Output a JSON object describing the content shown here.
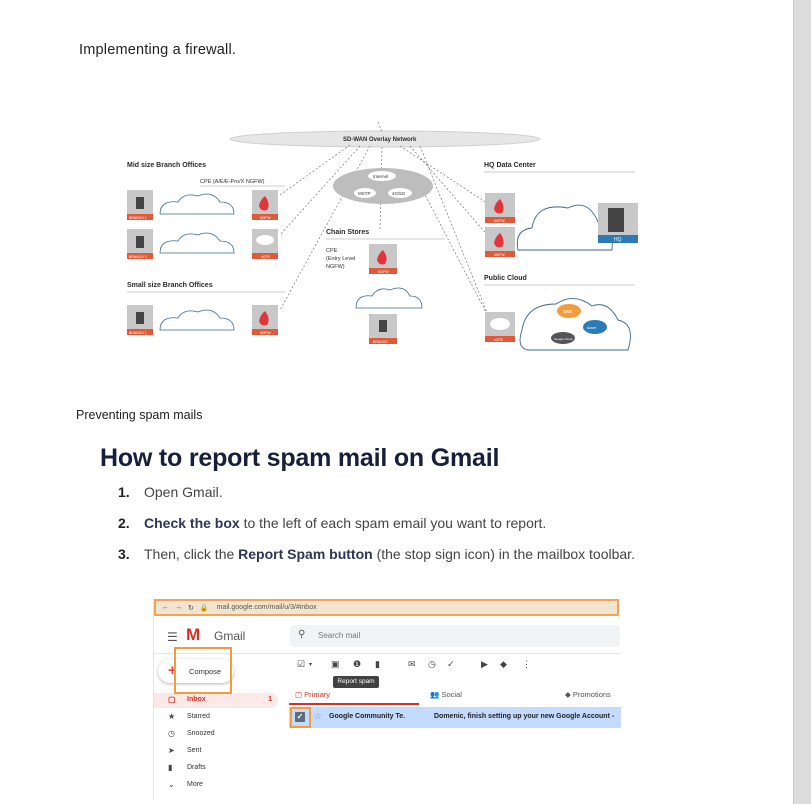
{
  "headings": {
    "firewall": "Implementing a firewall.",
    "spam": "Preventing spam mails"
  },
  "diagram": {
    "overlay": "SD-WAN Overlay Network",
    "mid_branch": "Mid size Branch Offices",
    "cpe_label": "CPE (A/E/E-Pro/X NGFW)",
    "internet": "Internet",
    "mstp": "MSTP",
    "g45": "4G/5G",
    "chain_stores": "Chain Stores",
    "cpe_entry_1": "CPE",
    "cpe_entry_2": "(Entry Level",
    "cpe_entry_3": "NGFW)",
    "small_branch": "Small size Branch Offices",
    "hq_dc": "HQ Data Center",
    "public_cloud": "Public Cloud",
    "branch1": "BRANCH 1",
    "branch2": "BRANCH 2",
    "branch": "BRANCH",
    "ngfw": "NGFW",
    "vcpe": "vCPE",
    "hq": "HQ",
    "aws": "aws",
    "azure": "Azure",
    "google": "Google Cloud"
  },
  "article": {
    "title": "How to report spam mail on Gmail",
    "steps": [
      {
        "num": "1.",
        "pre": "Open Gmail.",
        "bold": "",
        "post": ""
      },
      {
        "num": "2.",
        "pre": "",
        "bold": "Check the box",
        "post": " to the left of each spam email you want to report."
      },
      {
        "num": "3.",
        "pre": "Then, click the ",
        "bold": "Report Spam button",
        "post": " (the stop sign icon) in the mailbox toolbar."
      }
    ]
  },
  "gmail": {
    "url": "mail.google.com/mail/u/3/#inbox",
    "app_name": "Gmail",
    "search_placeholder": "Search mail",
    "compose": "Compose",
    "nav": [
      {
        "label": "Inbox",
        "count": "1",
        "icon": "inbox-icon",
        "glyph": "▢"
      },
      {
        "label": "Starred",
        "count": "",
        "icon": "star-icon",
        "glyph": "★"
      },
      {
        "label": "Snoozed",
        "count": "",
        "icon": "clock-icon",
        "glyph": "◷"
      },
      {
        "label": "Sent",
        "count": "",
        "icon": "send-icon",
        "glyph": "➤"
      },
      {
        "label": "Drafts",
        "count": "",
        "icon": "draft-icon",
        "glyph": "▮"
      },
      {
        "label": "More",
        "count": "",
        "icon": "chevron-down-icon",
        "glyph": "⌄"
      }
    ],
    "tooltip": "Report spam",
    "tabs": {
      "primary": "Primary",
      "social": "Social",
      "promotions": "Promotions"
    },
    "row": {
      "sender": "Google Community Te.",
      "subject": "Domenic, finish setting up your new Google Account -"
    },
    "accent": "#f39c3c"
  }
}
